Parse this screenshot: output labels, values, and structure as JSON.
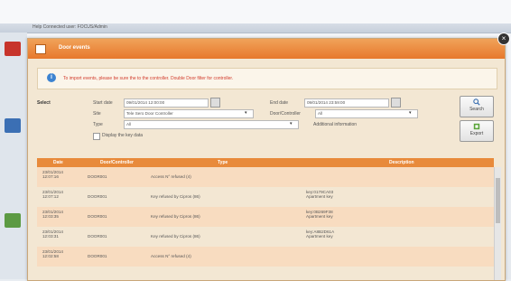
{
  "window": {
    "taskbar_title": "Help   Connected user: FOCUS/Admin",
    "dialog_title": "Door events",
    "close_glyph": "×"
  },
  "info": {
    "text": "To import events, please be sure the to the controller. Double Door filter for controller."
  },
  "form": {
    "select_label": "Select",
    "start_date_label": "Start date",
    "start_date_value": "09/01/2014 12:00:00",
    "end_date_label": "End date",
    "end_date_value": "09/01/2014 23:59:00",
    "site_label": "Site",
    "site_value": "Tele Sero Door Controller",
    "door_controller_label": "Door/Controller",
    "door_controller_value": "All",
    "type_label": "Type",
    "type_value": "All",
    "additional_label": "Additional information",
    "display_label": "Display the key data",
    "search_label": "Search",
    "export_label": "Export"
  },
  "table": {
    "headers": [
      "Date",
      "Door/Controller",
      "Type",
      "Description"
    ],
    "rows": [
      {
        "date": "23/01/2014\n12:07:16",
        "door": "DOOR001",
        "type": "Access N° refused (4)",
        "desc": ""
      },
      {
        "date": "23/01/2014\n12:07:12",
        "door": "DOOR001",
        "type": "Key refused by Cipros (86)",
        "desc": "key:0179CA03\nApartment key"
      },
      {
        "date": "23/01/2014\n12:03:35",
        "door": "DOOR001",
        "type": "Key refused by Cipros (86)",
        "desc": "key:0B269F38\nApartment key"
      },
      {
        "date": "23/01/2014\n12:03:31",
        "door": "DOOR001",
        "type": "Key refused by Cipros (86)",
        "desc": "key:A8B2D61A\nApartment key"
      },
      {
        "date": "23/01/2014\n12:02:58",
        "door": "DOOR001",
        "type": "Access N° refused (4)",
        "desc": ""
      }
    ]
  },
  "colors": {
    "accent_orange": "#e7782c",
    "header_orange": "#e88a3b",
    "info_red": "#d23b2b",
    "row_alt": "#f8dcc0"
  }
}
